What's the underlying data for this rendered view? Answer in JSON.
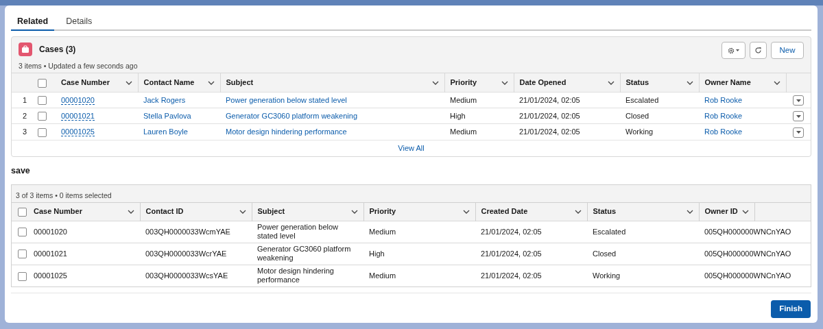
{
  "tabs": [
    {
      "label": "Related",
      "selected": true
    },
    {
      "label": "Details",
      "selected": false
    }
  ],
  "related_list": {
    "all_checked": false,
    "title": "Cases (3)",
    "meta": "3 items • Updated a few seconds ago",
    "new_button": "New",
    "columns": [
      {
        "label": "Case Number",
        "kind": "record-link"
      },
      {
        "label": "Contact Name",
        "kind": "link"
      },
      {
        "label": "Subject",
        "kind": "link"
      },
      {
        "label": "Priority",
        "kind": "text"
      },
      {
        "label": "Date Opened",
        "kind": "text"
      },
      {
        "label": "Status",
        "kind": "text"
      },
      {
        "label": "Owner Name",
        "kind": "link"
      }
    ],
    "rows": [
      {
        "number": "1",
        "checked": false,
        "cells": [
          "00001020",
          "Jack Rogers",
          "Power generation below stated level",
          "Medium",
          "21/01/2024, 02:05",
          "Escalated",
          "Rob Rooke"
        ]
      },
      {
        "number": "2",
        "checked": false,
        "cells": [
          "00001021",
          "Stella Pavlova",
          "Generator GC3060 platform weakening",
          "High",
          "21/01/2024, 02:05",
          "Closed",
          "Rob Rooke"
        ]
      },
      {
        "number": "3",
        "checked": false,
        "cells": [
          "00001025",
          "Lauren Boyle",
          "Motor design hindering performance",
          "Medium",
          "21/01/2024, 02:05",
          "Working",
          "Rob Rooke"
        ]
      }
    ],
    "view_all": "View All"
  },
  "section_title": "save",
  "data_table": {
    "summary": "3 of 3 items • 0 items selected",
    "all_checked": false,
    "columns": [
      "Case Number",
      "Contact ID",
      "Subject",
      "Priority",
      "Created Date",
      "Status",
      "Owner ID"
    ],
    "rows": [
      {
        "checked": false,
        "cells": [
          "00001020",
          "003QH0000033WcmYAE",
          "Power generation below stated level",
          "Medium",
          "21/01/2024, 02:05",
          "Escalated",
          "005QH000000WNCnYAO"
        ]
      },
      {
        "checked": false,
        "cells": [
          "00001021",
          "003QH0000033WcrYAE",
          "Generator GC3060 platform weakening",
          "High",
          "21/01/2024, 02:05",
          "Closed",
          "005QH000000WNCnYAO"
        ]
      },
      {
        "checked": false,
        "cells": [
          "00001025",
          "003QH0000033WcsYAE",
          "Motor design hindering performance",
          "Medium",
          "21/01/2024, 02:05",
          "Working",
          "005QH000000WNCnYAO"
        ]
      }
    ]
  },
  "finish_button": "Finish"
}
